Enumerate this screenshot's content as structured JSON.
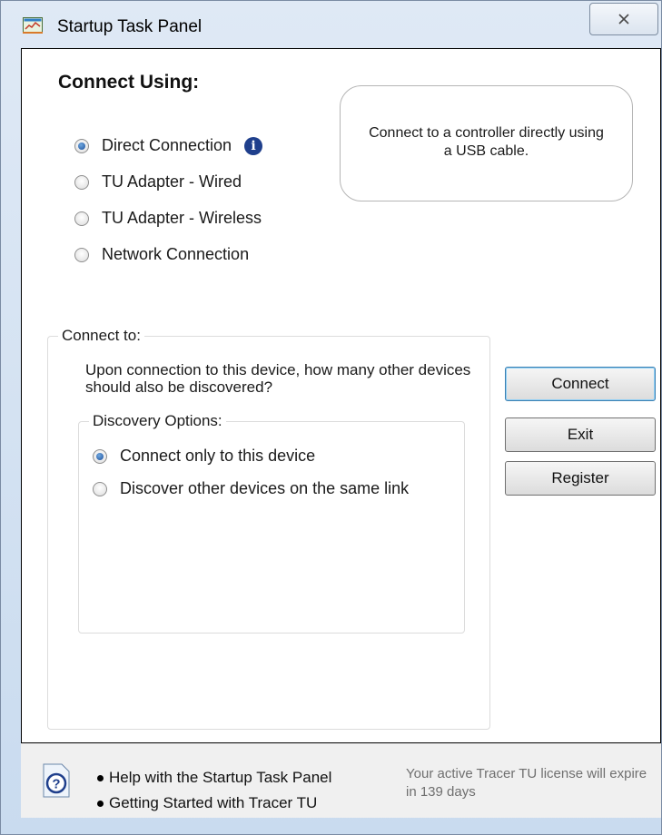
{
  "window": {
    "title": "Startup Task Panel",
    "close_glyph": "X"
  },
  "connect_using": {
    "heading": "Connect Using:",
    "options": [
      {
        "label": "Direct Connection",
        "checked": true
      },
      {
        "label": "TU Adapter - Wired",
        "checked": false
      },
      {
        "label": "TU Adapter - Wireless",
        "checked": false
      },
      {
        "label": "Network Connection",
        "checked": false
      }
    ],
    "info_glyph": "i",
    "description": "Connect to a controller directly using a USB cable."
  },
  "connect_to": {
    "label": "Connect to:",
    "question": "Upon connection to this device, how many other devices should also be discovered?",
    "discovery": {
      "label": "Discovery Options:",
      "options": [
        {
          "label": "Connect only to this device",
          "checked": true
        },
        {
          "label": "Discover other devices on the same link",
          "checked": false
        }
      ]
    }
  },
  "buttons": {
    "connect": "Connect",
    "exit": "Exit",
    "register": "Register"
  },
  "footer": {
    "help_glyph": "?",
    "links": [
      "Help with the Startup Task Panel",
      "Getting Started with Tracer TU"
    ],
    "license": "Your active Tracer TU license will expire in 139 days"
  },
  "colors": {
    "accent": "#1d4f9a",
    "info": "#1f3f8c",
    "license_text": "#6f6f6f"
  }
}
